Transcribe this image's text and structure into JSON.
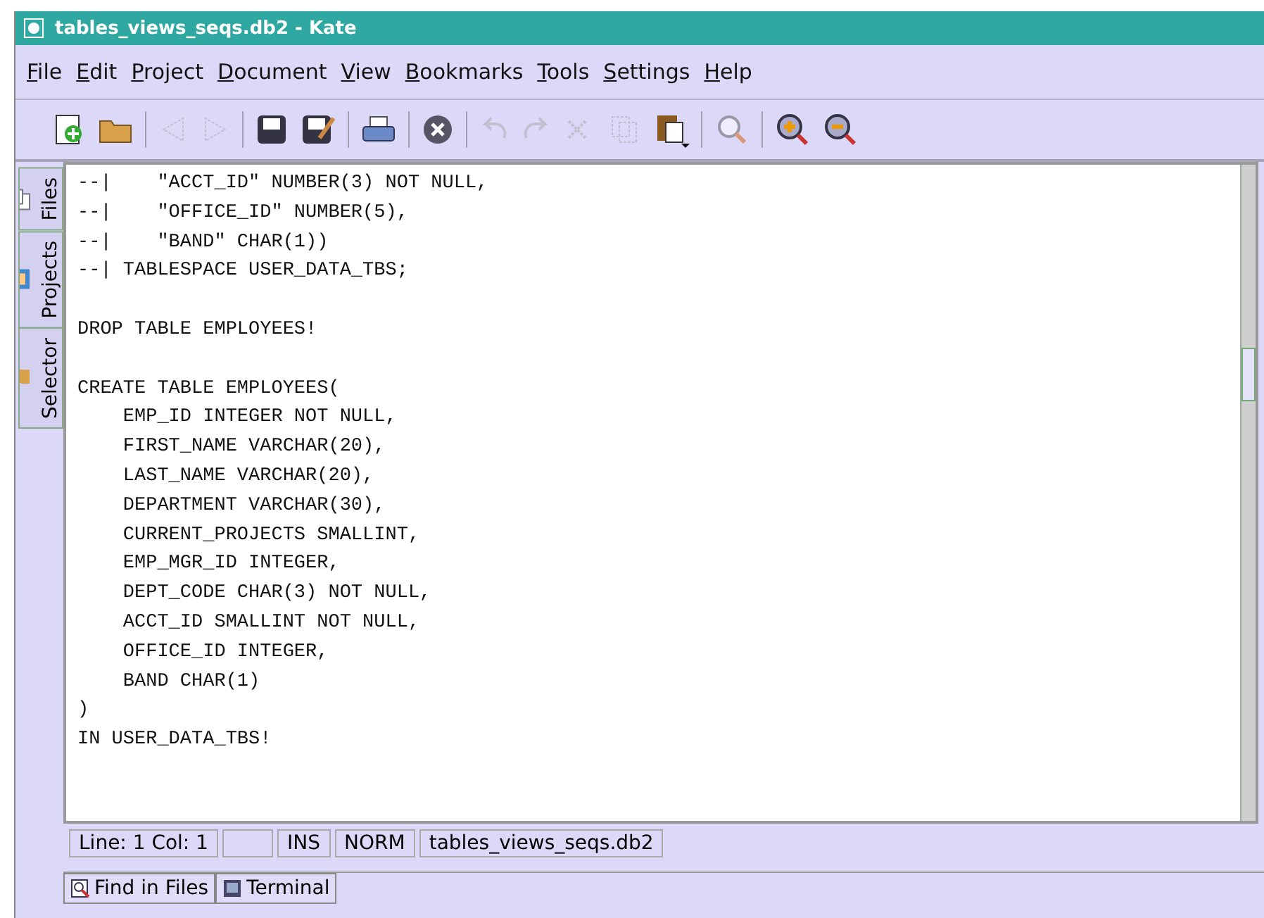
{
  "window": {
    "title": "tables_views_seqs.db2 - Kate"
  },
  "menu": [
    "File",
    "Edit",
    "Project",
    "Document",
    "View",
    "Bookmarks",
    "Tools",
    "Settings",
    "Help"
  ],
  "toolbar": [
    [
      {
        "kind": "new",
        "disabled": false
      },
      {
        "kind": "open",
        "disabled": false
      }
    ],
    [
      {
        "kind": "back",
        "disabled": true
      },
      {
        "kind": "forward",
        "disabled": true
      }
    ],
    [
      {
        "kind": "save",
        "disabled": false
      },
      {
        "kind": "saveas",
        "disabled": false
      }
    ],
    [
      {
        "kind": "print",
        "disabled": false
      }
    ],
    [
      {
        "kind": "close",
        "disabled": false
      }
    ],
    [
      {
        "kind": "undo",
        "disabled": true
      },
      {
        "kind": "redo",
        "disabled": true
      },
      {
        "kind": "cut",
        "disabled": true
      },
      {
        "kind": "copy",
        "disabled": true
      },
      {
        "kind": "paste",
        "disabled": false
      }
    ],
    [
      {
        "kind": "find",
        "disabled": false
      }
    ],
    [
      {
        "kind": "zoomin",
        "disabled": false
      },
      {
        "kind": "zoomout",
        "disabled": false
      }
    ]
  ],
  "side_tabs": [
    {
      "label": "Files",
      "kind": "files"
    },
    {
      "label": "Projects",
      "kind": "projects"
    },
    {
      "label": "Selector",
      "kind": "selector"
    }
  ],
  "editor": {
    "lines": [
      {
        "text": "--|    \"ACCT_ID\" NUMBER(3) NOT NULL,",
        "blank_before": false
      },
      {
        "text": "--|    \"OFFICE_ID\" NUMBER(5),",
        "blank_before": false
      },
      {
        "text": "--|    \"BAND\" CHAR(1))",
        "blank_before": false
      },
      {
        "text": "--| TABLESPACE USER_DATA_TBS;",
        "blank_before": false
      },
      {
        "text": "DROP TABLE EMPLOYEES!",
        "blank_before": true
      },
      {
        "text": "CREATE TABLE EMPLOYEES(",
        "blank_before": true
      },
      {
        "text": "    EMP_ID INTEGER NOT NULL,",
        "blank_before": false
      },
      {
        "text": "    FIRST_NAME VARCHAR(20),",
        "blank_before": false
      },
      {
        "text": "    LAST_NAME VARCHAR(20),",
        "blank_before": false
      },
      {
        "text": "    DEPARTMENT VARCHAR(30),",
        "blank_before": false
      },
      {
        "text": "    CURRENT_PROJECTS SMALLINT,",
        "blank_before": false
      },
      {
        "text": "    EMP_MGR_ID INTEGER,",
        "blank_before": false
      },
      {
        "text": "    DEPT_CODE CHAR(3) NOT NULL,",
        "blank_before": false
      },
      {
        "text": "    ACCT_ID SMALLINT NOT NULL,",
        "blank_before": false
      },
      {
        "text": "    OFFICE_ID INTEGER,",
        "blank_before": false
      },
      {
        "text": "    BAND CHAR(1)",
        "blank_before": false
      },
      {
        "text": ")",
        "blank_before": false
      },
      {
        "text": "IN USER_DATA_TBS!",
        "blank_before": false
      }
    ]
  },
  "status_bar": [
    "Line: 1 Col: 1",
    "INS",
    "NORM",
    "tables_views_seqs.db2"
  ],
  "bottom_tabs": [
    {
      "label": "Find in Files",
      "kind": "find"
    },
    {
      "label": "Terminal",
      "kind": "terminal"
    }
  ]
}
